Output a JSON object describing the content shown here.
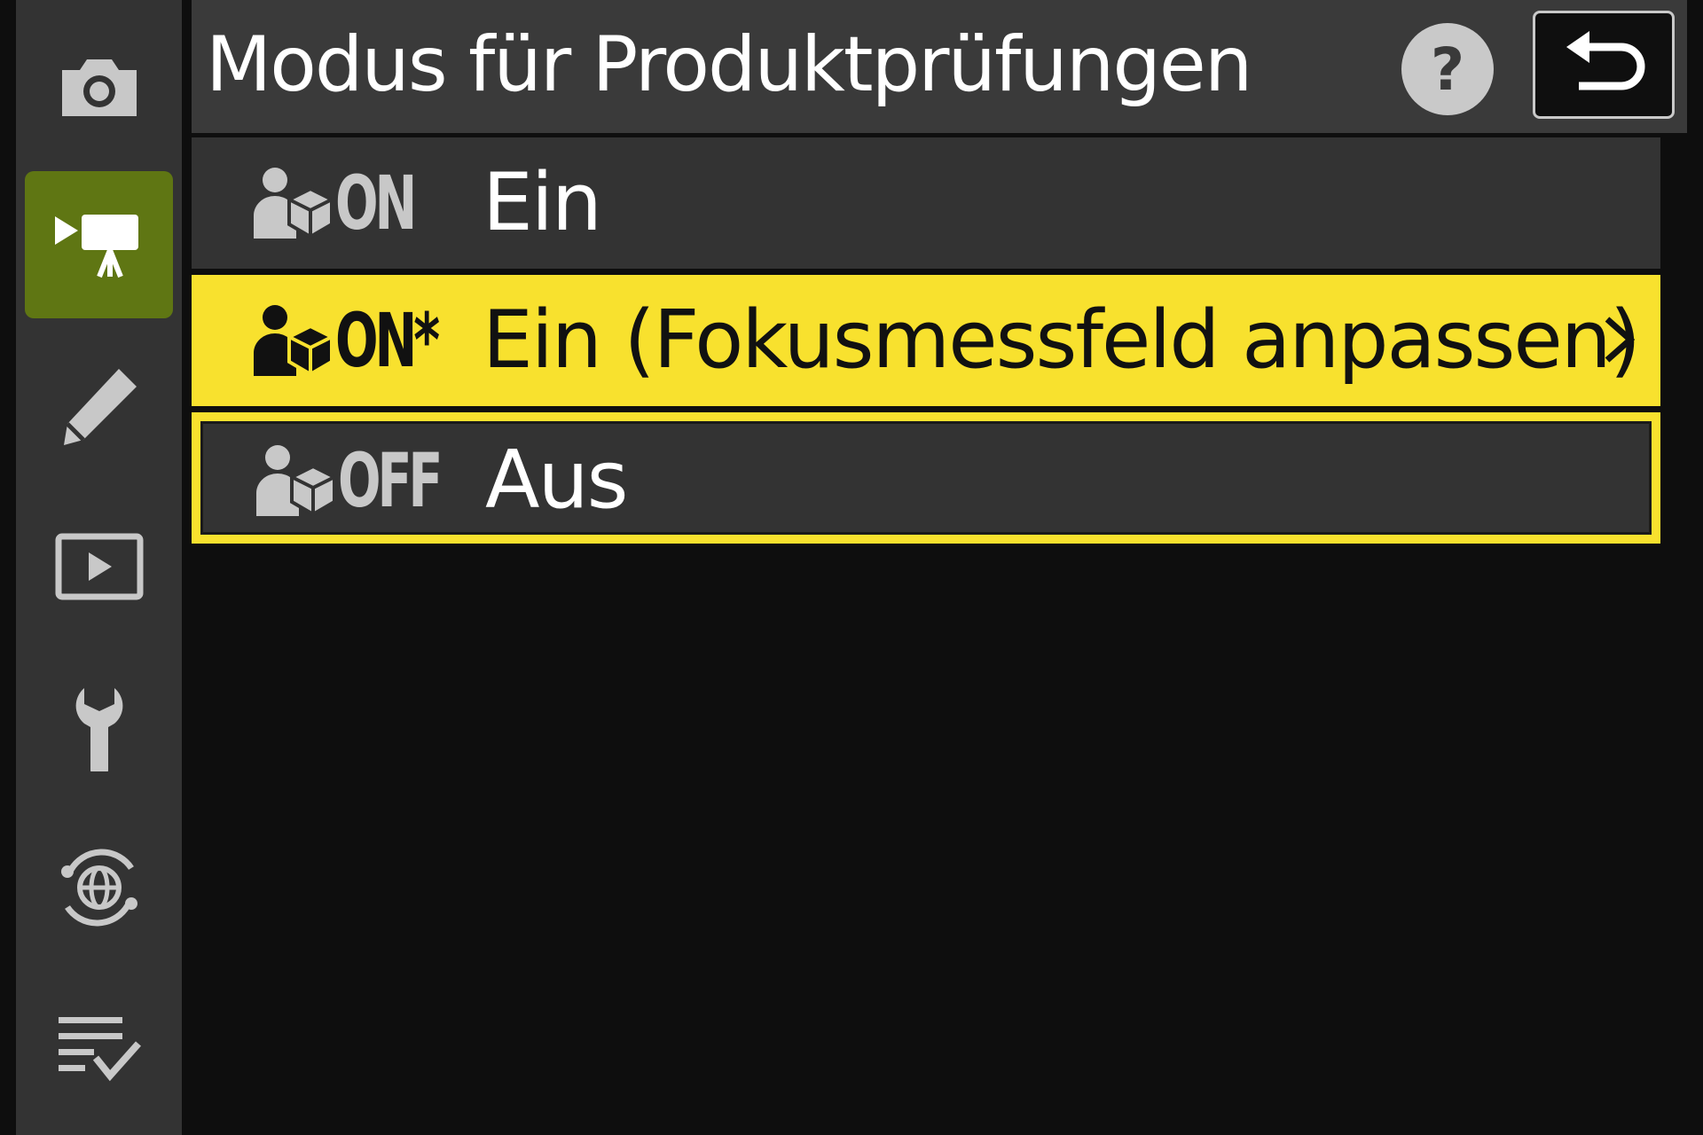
{
  "header": {
    "title": "Modus für Produktprüfungen",
    "help_glyph": "?",
    "back_icon": "return-arrow-icon"
  },
  "tabs": [
    {
      "icon": "camera-icon",
      "active": false
    },
    {
      "icon": "movie-camera-icon",
      "active": true
    },
    {
      "icon": "pencil-icon",
      "active": false
    },
    {
      "icon": "playback-icon",
      "active": false
    },
    {
      "icon": "wrench-icon",
      "active": false
    },
    {
      "icon": "network-globe-icon",
      "active": false
    },
    {
      "icon": "my-menu-checklist-icon",
      "active": false
    }
  ],
  "menu": {
    "options": [
      {
        "tag": "ON",
        "label": "Ein",
        "icon": "product-review-person-icon"
      },
      {
        "tag": "ON*",
        "label": "Ein (Fokusmessfeld anpassen)",
        "icon": "product-review-person-icon",
        "highlighted": true,
        "has_submenu": true
      },
      {
        "tag": "OFF",
        "label": "Aus",
        "icon": "product-review-person-icon",
        "selected_frame": true
      }
    ]
  },
  "colors": {
    "highlight": "#f8e12e",
    "active_tab": "#5f7613",
    "panel": "#333333",
    "background": "#0e0e0e"
  }
}
